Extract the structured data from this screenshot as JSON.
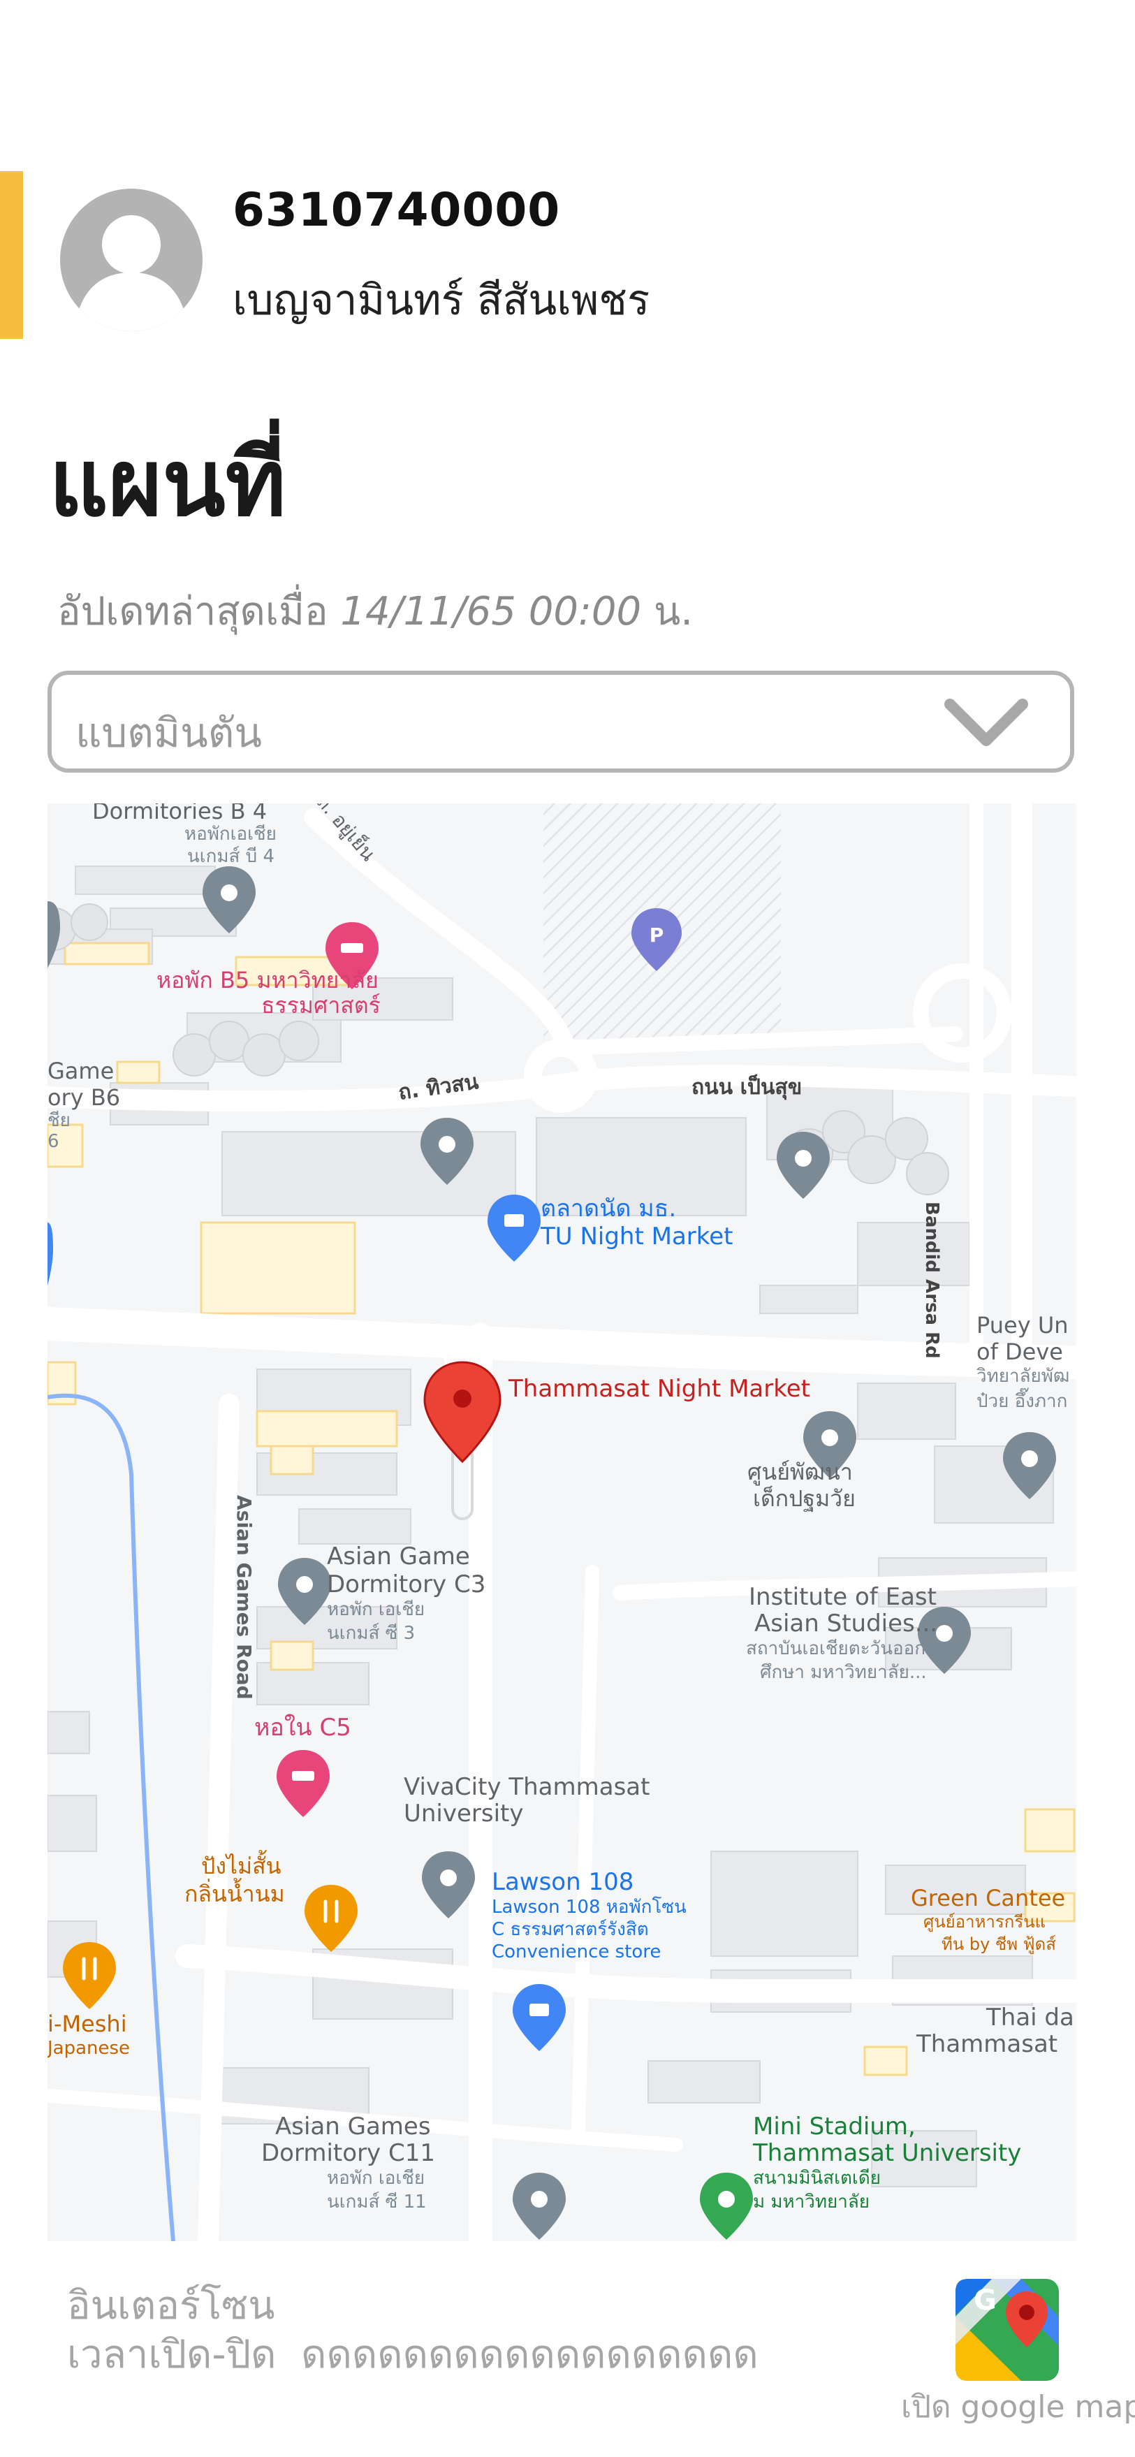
{
  "profile": {
    "student_id": "6310740000",
    "name": "เบญจามินทร์ สีสันเพชร"
  },
  "page": {
    "title": "แผนที่",
    "updated_prefix": "อัปเดทล่าสุดเมื่อ",
    "updated_time": "14/11/65 00:00",
    "updated_suffix": "น."
  },
  "sport_select": {
    "value": "แบตมินตัน"
  },
  "map": {
    "labels": {
      "dorm_b4_en": "Dormitories B 4",
      "dorm_b4_th": "หอพักเอเชีย",
      "dorm_b4_th2": "นเกมส์ บี 4",
      "road_top": "ถ. อยู่เย็น",
      "dorm_b5": "หอพัก B5 มหาวิทยาลัย",
      "dorm_b5_2": "ธรรมศาสตร์",
      "game_b6_1": "Game",
      "game_b6_2": "ory B6",
      "game_b6_3": "ชีย",
      "game_b6_4": "6",
      "road_tiwason": "ถ. ทิวสน",
      "road_penpsuk": "ถนน เป็นสุข",
      "road_bandid": "Bandid Arsa Rd",
      "night_market_th": "ตลาดนัด มธ.",
      "night_market_en": "TU Night Market",
      "puey_1": "Puey Un",
      "puey_2": "of Deve",
      "puey_3": "วิทยาลัยพัฒ",
      "puey_4": "ป๋วย อึ๊งภาก",
      "thammasat_night_market": "Thammasat Night Market",
      "child_dev_1": "ศูนย์พัฒนา",
      "child_dev_2": "เด็กปฐมวัย",
      "asian_games_road": "Asian Games Road",
      "c3_1": "Asian Game",
      "c3_2": "Dormitory C3",
      "c3_3": "หอพัก เอเชีย",
      "c3_4": "นเกมส์ ซี 3",
      "east_asian_1": "Institute of East",
      "east_asian_2": "Asian Studies...",
      "east_asian_3": "สถาบันเอเชียตะวันออก",
      "east_asian_4": "ศึกษา มหาวิทยาลัย...",
      "c5": "หอใน C5",
      "vivacity_1": "VivaCity Thammasat",
      "vivacity_2": "University",
      "restaurant_1": "ปังไม่สั้น",
      "restaurant_2": "กลิ่นน้ำนม",
      "lawson_1": "Lawson 108",
      "lawson_2": "Lawson 108 หอพักโซน",
      "lawson_3": "C ธรรมศาสตร์รังสิต",
      "lawson_4": "Convenience store",
      "green_canteen_1": "Green Cantee",
      "green_canteen_2": "ศูนย์อาหารกรีนแ",
      "green_canteen_3": "ทีน by ชีพ ฟู้ดส์",
      "meshi_1": "i-Meshi",
      "meshi_2": "Japanese",
      "thai_1": "Thai da",
      "thai_2": "Thammasat",
      "c11_1": "Asian Games",
      "c11_2": "Dormitory C11",
      "c11_3": "หอพัก เอเชีย",
      "c11_4": "นเกมส์ ซี 11",
      "stadium_1": "Mini Stadium,",
      "stadium_2": "Thammasat University",
      "stadium_3": "สนามมินิสเตเดีย",
      "stadium_4": "ม มหาวิทยาลัย"
    }
  },
  "footer": {
    "place": "อินเตอร์โซน",
    "hours_label": "เวลาเปิด-ปิด",
    "hours_value": "ดดดดดดดดดดดดดดดดดด",
    "open_map": "เปิด google map"
  },
  "colors": {
    "accent": "#F5BE3C",
    "map_bg": "#F5F6F7",
    "marker_red": "#EA4335",
    "poi_blue": "#4285F4",
    "poi_pink": "#E8457A",
    "poi_orange": "#F29900",
    "poi_green": "#34A853"
  }
}
